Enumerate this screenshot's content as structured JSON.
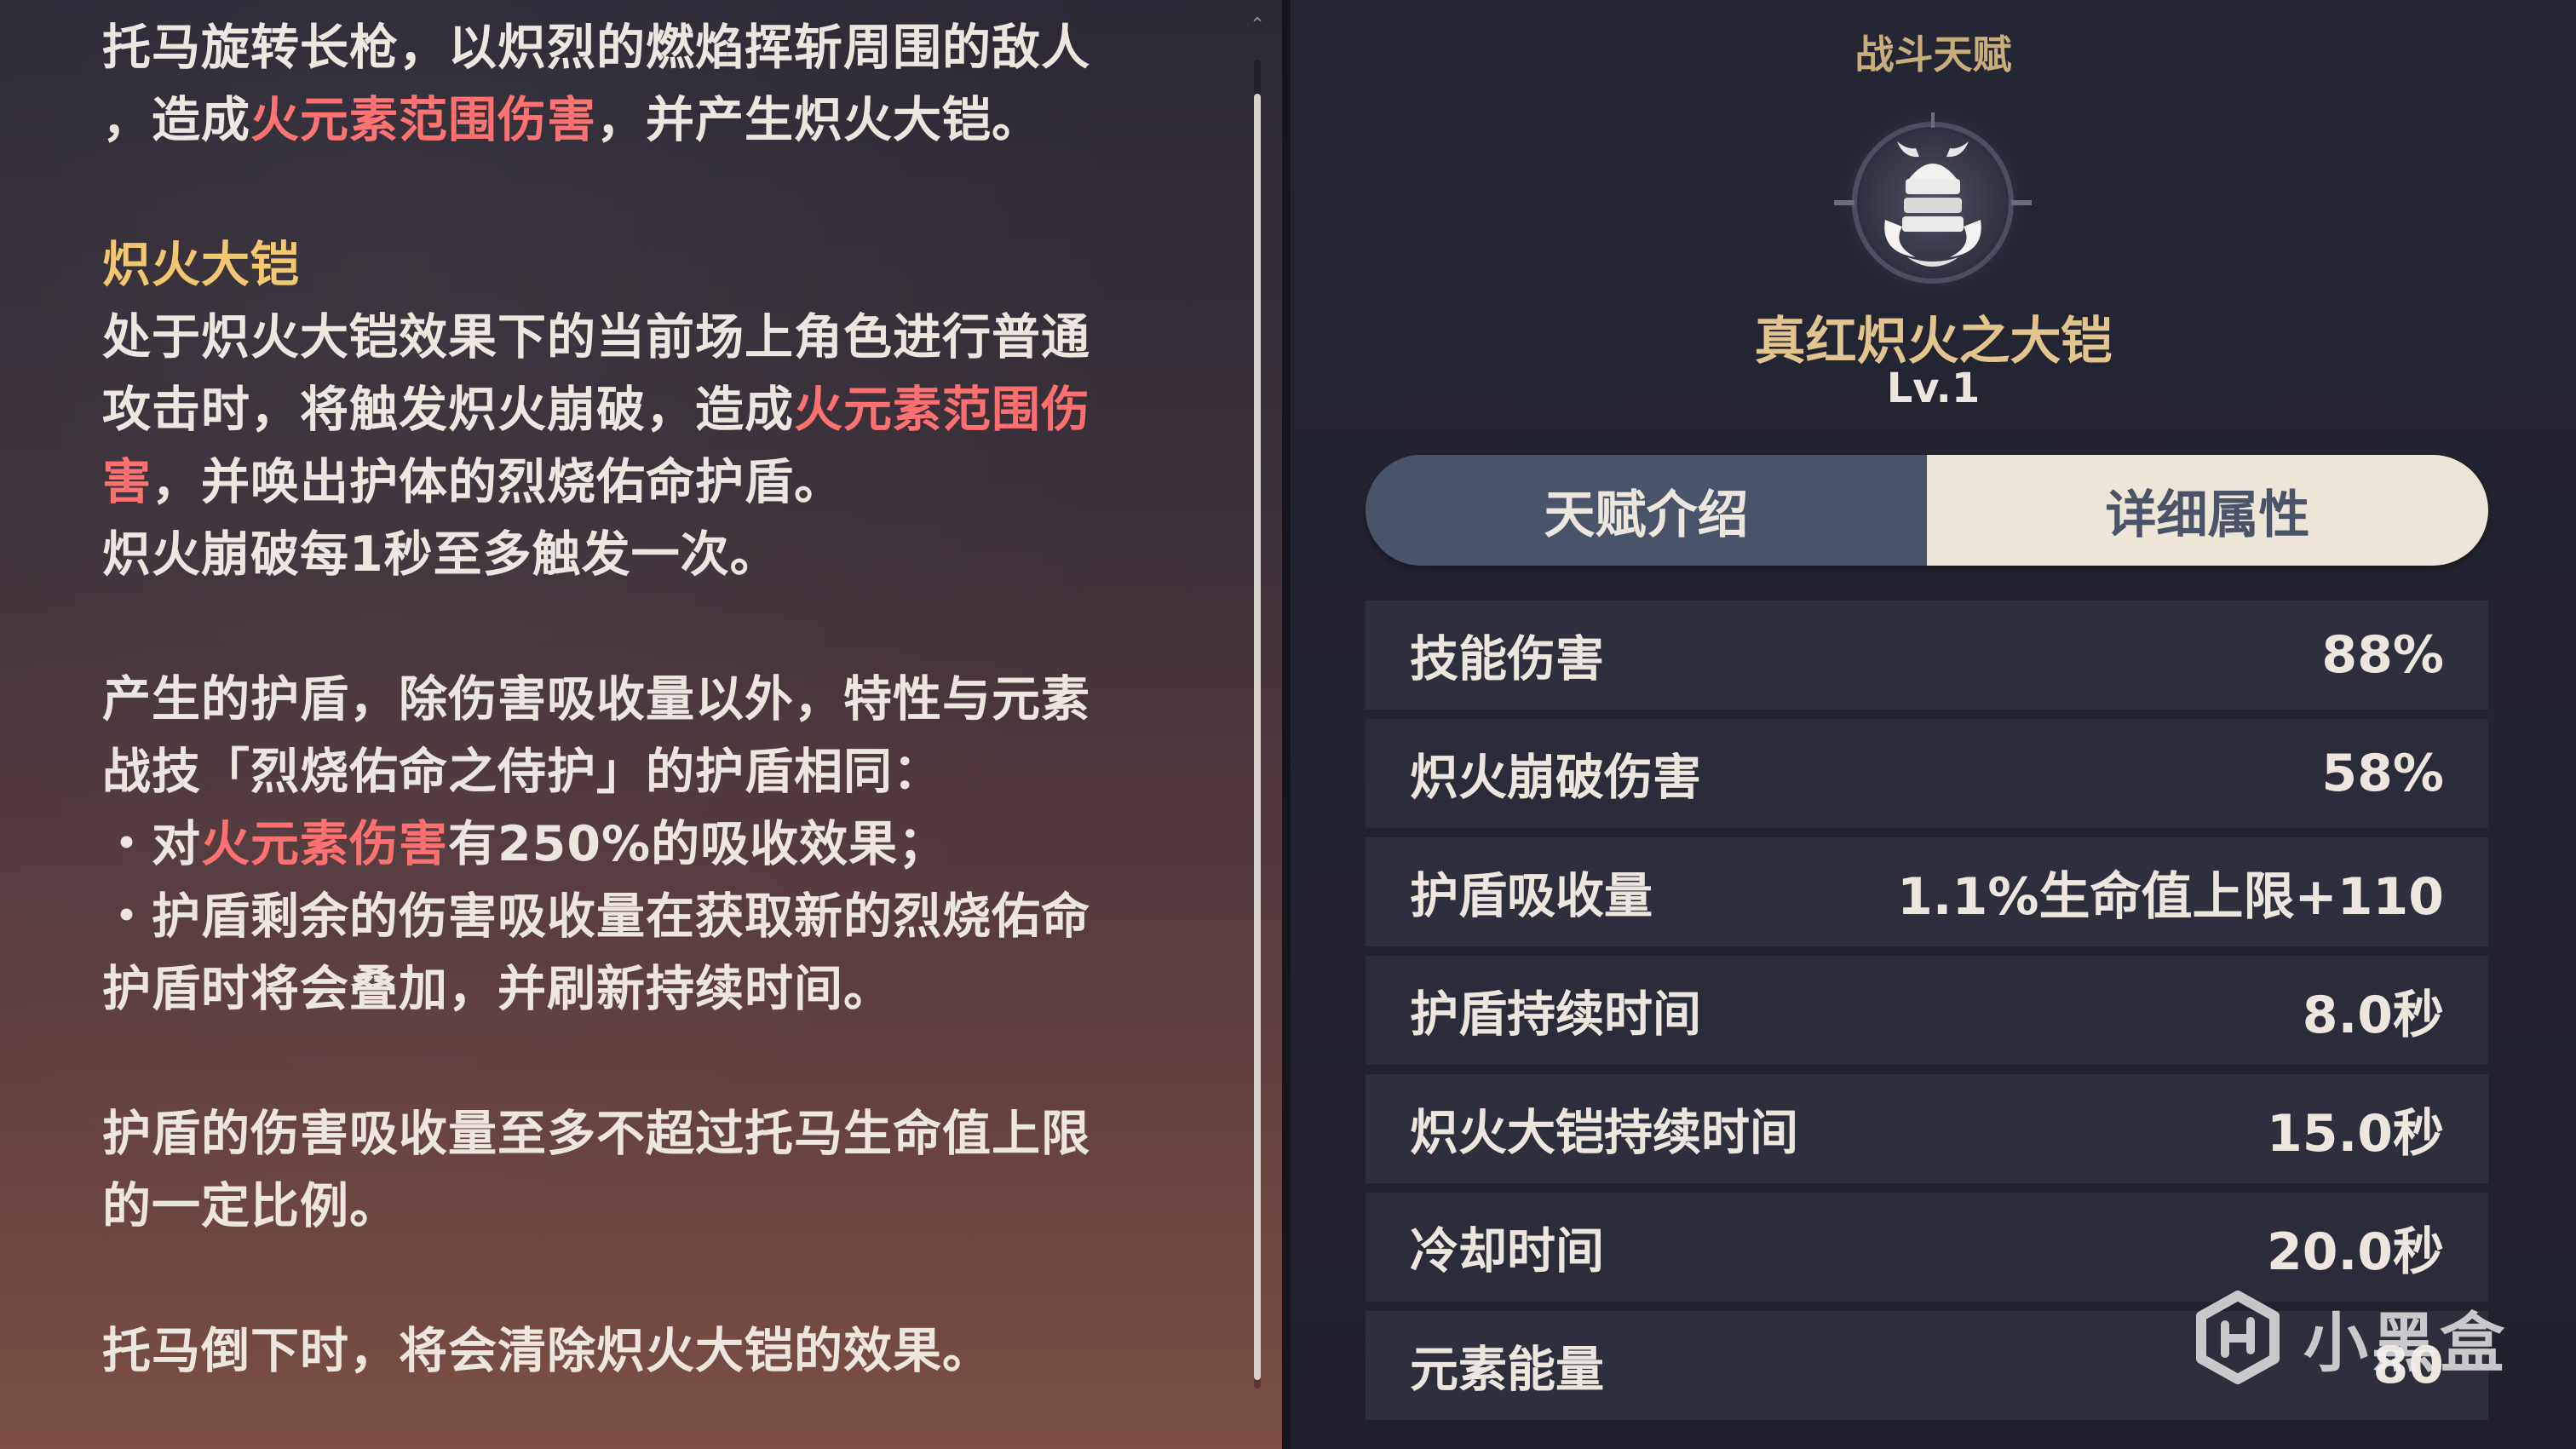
{
  "description": {
    "intro_line1": "托马旋转长枪，以炽烈的燃焰挥斩周围的敌人",
    "intro_line2_a": "，造成",
    "intro_line2_highlight": "火元素范围伤害",
    "intro_line2_b": "，并产生炽火大铠。",
    "section_title": "炽火大铠",
    "p2_line1": "处于炽火大铠效果下的当前场上角色进行普通",
    "p2_line2_a": "攻击时，将触发炽火崩破，造成",
    "p2_line2_highlight": "火元素范围伤",
    "p2_line3_highlight": "害",
    "p2_line3_b": "，并唤出护体的烈烧佑命护盾。",
    "p2_line4": "炽火崩破每1秒至多触发一次。",
    "p3_line1": "产生的护盾，除伤害吸收量以外，特性与元素",
    "p3_line2": "战技「烈烧佑命之侍护」的护盾相同：",
    "p3_bullet1_a": "・对",
    "p3_bullet1_highlight": "火元素伤害",
    "p3_bullet1_b": "有250%的吸收效果；",
    "p3_bullet2_line1": "・护盾剩余的伤害吸收量在获取新的烈烧佑命",
    "p3_bullet2_line2": "护盾时将会叠加，并刷新持续时间。",
    "p4_line1": "护盾的伤害吸收量至多不超过托马生命值上限",
    "p4_line2": "的一定比例。",
    "p5_line1": "托马倒下时，将会清除炽火大铠的效果。"
  },
  "talent": {
    "type_label": "战斗天赋",
    "emblem_icon": "samurai-armor-emblem-icon",
    "name": "真红炽火之大铠",
    "level": "Lv.1"
  },
  "tabs": [
    {
      "label": "天赋介绍",
      "active": false
    },
    {
      "label": "详细属性",
      "active": true
    }
  ],
  "attributes": [
    {
      "name": "技能伤害",
      "value": "88%"
    },
    {
      "name": "炽火崩破伤害",
      "value": "58%"
    },
    {
      "name": "护盾吸收量",
      "value": "1.1%生命值上限+110"
    },
    {
      "name": "护盾持续时间",
      "value": "8.0秒"
    },
    {
      "name": "炽火大铠持续时间",
      "value": "15.0秒"
    },
    {
      "name": "冷却时间",
      "value": "20.0秒"
    },
    {
      "name": "元素能量",
      "value": "80"
    }
  ],
  "watermark": {
    "text": "小黑盒",
    "icon": "heybox-logo-icon"
  },
  "colors": {
    "highlight_red": "#ff6e6e",
    "highlight_gold": "#f2c66b",
    "talent_gold": "#e2c58e",
    "tab_inactive": "#4a5469",
    "tab_active": "#ece5d8"
  }
}
